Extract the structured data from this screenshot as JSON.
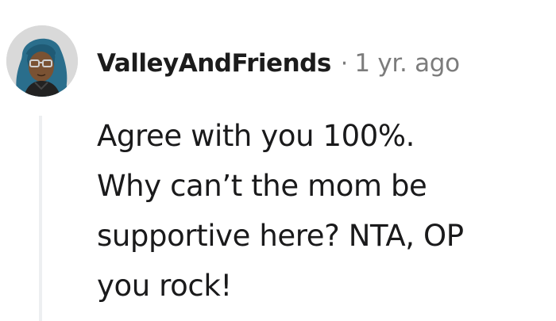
{
  "comment": {
    "author": "ValleyAndFriends",
    "separator": "·",
    "time": "1 yr. ago",
    "lines": [
      "Agree with you 100%.",
      "Why can’t the mom be",
      "supportive here? NTA, OP",
      "you rock!"
    ]
  },
  "colors": {
    "text": "#1a1a1b",
    "meta": "#7c7c7c",
    "thread_line": "#edeff1",
    "avatar_hair": "#2a6e8c",
    "avatar_skin": "#7a5233"
  },
  "icons": {
    "avatar": "user-avatar-illustration"
  }
}
